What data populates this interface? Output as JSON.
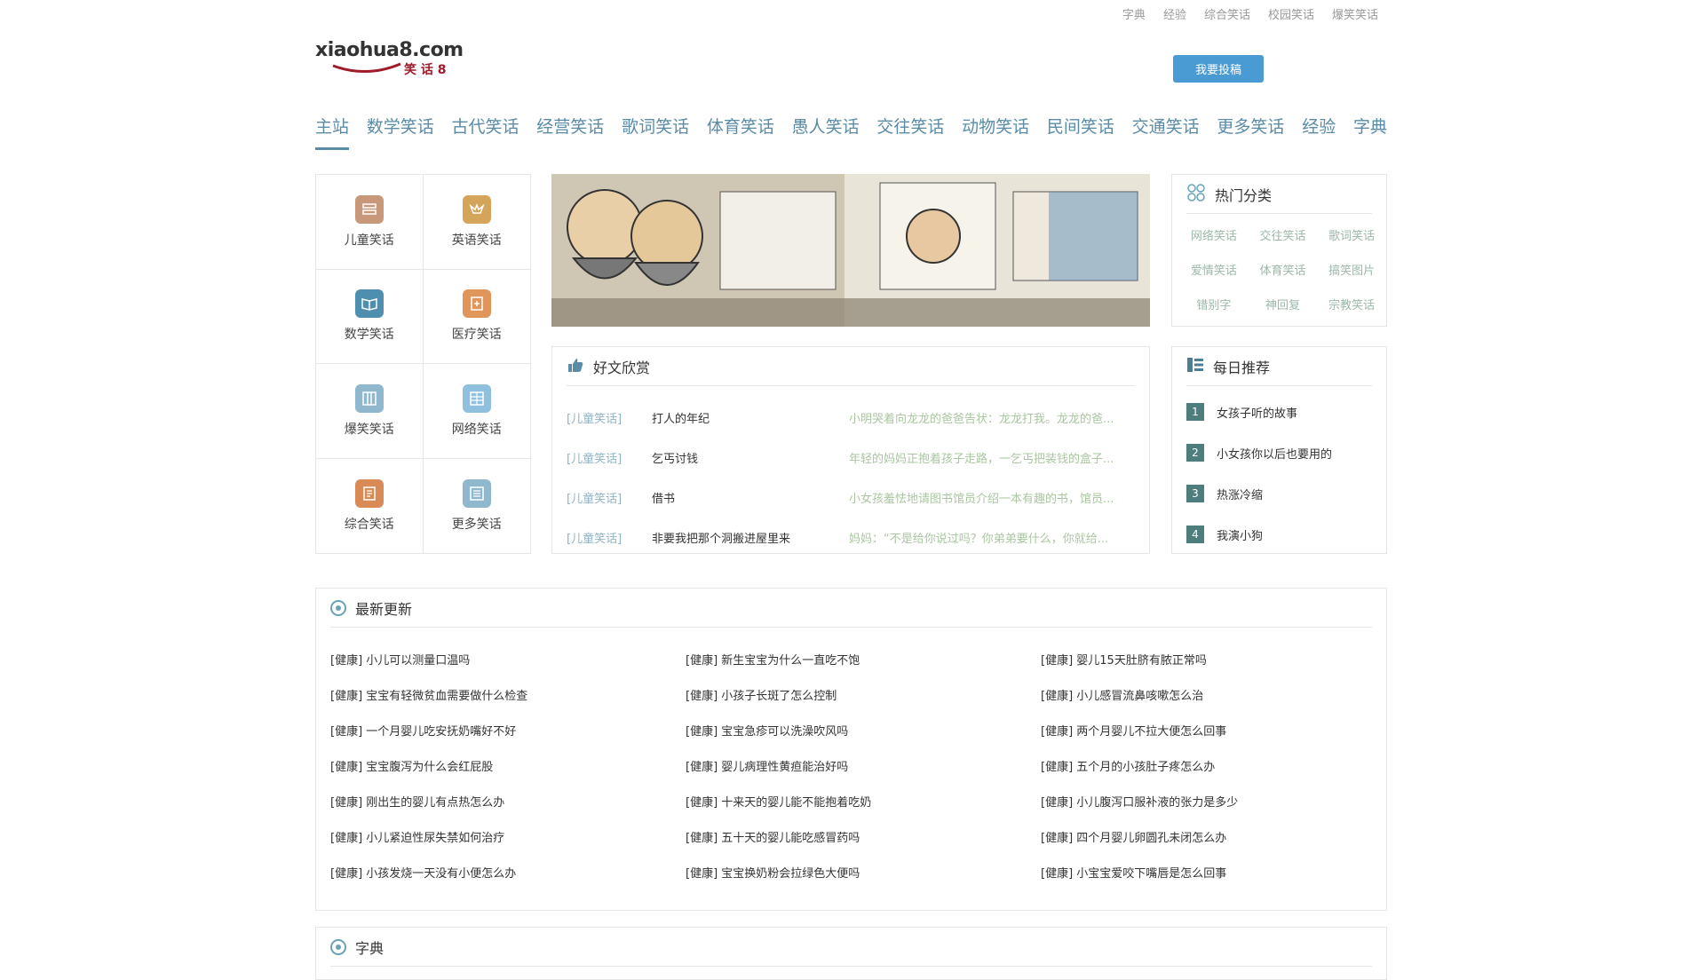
{
  "top_links": [
    "字典",
    "经验",
    "综合笑话",
    "校园笑话",
    "爆笑笑话"
  ],
  "logo": {
    "main": "xiaohua8.com",
    "sub": "笑 话 8"
  },
  "submit_label": "我要投稿",
  "nav": [
    "主站",
    "数学笑话",
    "古代笑话",
    "经营笑话",
    "歌词笑话",
    "体育笑话",
    "愚人笑话",
    "交往笑话",
    "动物笑话",
    "民间笑话",
    "交通笑话",
    "更多笑话",
    "经验",
    "字典"
  ],
  "categories": [
    {
      "label": "儿童笑话",
      "icon": "book-stack-icon",
      "color": "#c9977a"
    },
    {
      "label": "英语笑话",
      "icon": "crown-icon",
      "color": "#d4a45a"
    },
    {
      "label": "数学笑话",
      "icon": "open-book-icon",
      "color": "#4e8fb0"
    },
    {
      "label": "医疗笑话",
      "icon": "medical-card-icon",
      "color": "#e0955a"
    },
    {
      "label": "爆笑笑话",
      "icon": "columns-icon",
      "color": "#8fb8cf"
    },
    {
      "label": "网络笑话",
      "icon": "grid-icon",
      "color": "#8fc0dd"
    },
    {
      "label": "综合笑话",
      "icon": "document-icon",
      "color": "#d98b55"
    },
    {
      "label": "更多笑话",
      "icon": "list-icon",
      "color": "#8fb8cf"
    }
  ],
  "articles": {
    "title": "好文欣赏",
    "rows": [
      {
        "cat": "[儿童笑话]",
        "title": "打人的年纪",
        "excerpt": "小明哭着向龙龙的爸爸告状：龙龙打我。龙龙的爸..."
      },
      {
        "cat": "[儿童笑话]",
        "title": "乞丐讨钱",
        "excerpt": "年轻的妈妈正抱着孩子走路，一乞丐把装钱的盒子..."
      },
      {
        "cat": "[儿童笑话]",
        "title": "借书",
        "excerpt": "小女孩羞怯地请图书馆员介绍一本有趣的书，馆员..."
      },
      {
        "cat": "[儿童笑话]",
        "title": "非要我把那个洞搬进屋里来",
        "excerpt": "妈妈：“不是给你说过吗？你弟弟要什么，你就给..."
      }
    ]
  },
  "hot": {
    "title": "热门分类",
    "tags": [
      "网络笑话",
      "交往笑话",
      "歌词笑话",
      "爱情笑话",
      "体育笑话",
      "搞笑图片",
      "错别字",
      "神回复",
      "宗教笑话"
    ]
  },
  "daily": {
    "title": "每日推荐",
    "items": [
      {
        "n": "1",
        "t": "女孩子听的故事"
      },
      {
        "n": "2",
        "t": "小女孩你以后也要用的"
      },
      {
        "n": "3",
        "t": "热涨冷缩"
      },
      {
        "n": "4",
        "t": "我演小狗"
      }
    ]
  },
  "latest": {
    "title": "最新更新",
    "items": [
      "[健康] 小儿可以测量口温吗",
      "[健康] 新生宝宝为什么一直吃不饱",
      "[健康] 婴儿15天肚脐有脓正常吗",
      "[健康] 宝宝有轻微贫血需要做什么检查",
      "[健康] 小孩子长斑了怎么控制",
      "[健康] 小儿感冒流鼻咳嗽怎么治",
      "[健康] 一个月婴儿吃安抚奶嘴好不好",
      "[健康] 宝宝急疹可以洗澡吹风吗",
      "[健康] 两个月婴儿不拉大便怎么回事",
      "[健康] 宝宝腹泻为什么会红屁股",
      "[健康] 婴儿病理性黄疸能治好吗",
      "[健康] 五个月的小孩肚子疼怎么办",
      "[健康] 刚出生的婴儿有点热怎么办",
      "[健康] 十来天的婴儿能不能抱着吃奶",
      "[健康] 小儿腹泻口服补液的张力是多少",
      "[健康] 小儿紧迫性尿失禁如何治疗",
      "[健康] 五十天的婴儿能吃感冒药吗",
      "[健康] 四个月婴儿卵圆孔未闭怎么办",
      "[健康] 小孩发烧一天没有小便怎么办",
      "[健康] 宝宝换奶粉会拉绿色大便吗",
      "[健康] 小宝宝爱咬下嘴唇是怎么回事"
    ]
  },
  "dict": {
    "title": "字典"
  }
}
